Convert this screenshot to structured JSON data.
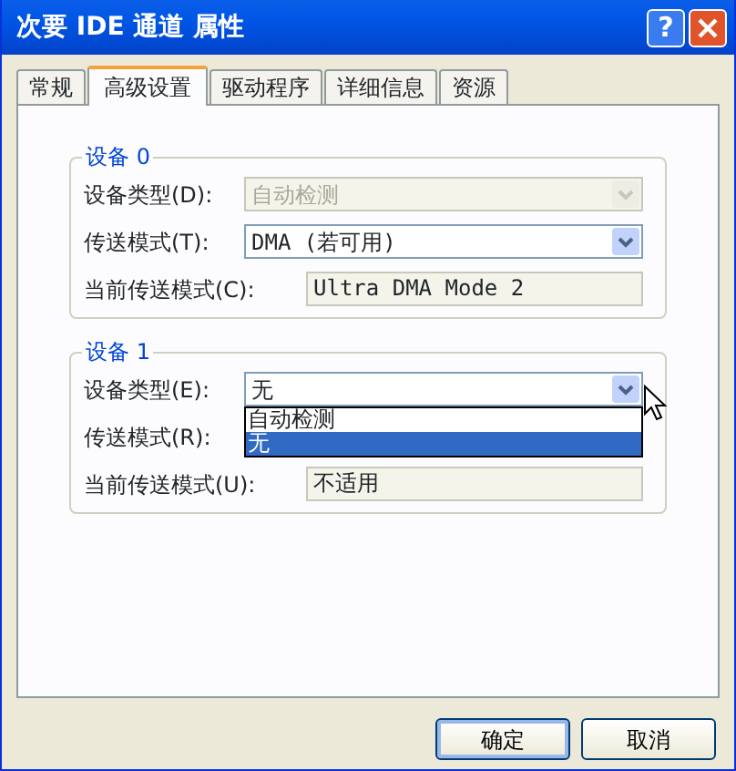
{
  "window": {
    "title": "次要 IDE 通道 属性",
    "help": "?"
  },
  "tabs": [
    {
      "label": "常规",
      "selected": false
    },
    {
      "label": "高级设置",
      "selected": true
    },
    {
      "label": "驱动程序",
      "selected": false
    },
    {
      "label": "详细信息",
      "selected": false
    },
    {
      "label": "资源",
      "selected": false
    }
  ],
  "groups": [
    {
      "title": "设备 0",
      "rows": [
        {
          "kind": "combo",
          "label": "设备类型(D):",
          "value": "自动检测",
          "disabled": true,
          "expanded": false
        },
        {
          "kind": "combo",
          "label": "传送模式(T):",
          "value": "DMA (若可用)",
          "disabled": false,
          "expanded": false
        },
        {
          "kind": "readonly",
          "label": "当前传送模式(C):",
          "value": "Ultra DMA Mode 2"
        }
      ]
    },
    {
      "title": "设备 1",
      "rows": [
        {
          "kind": "combo",
          "label": "设备类型(E):",
          "value": "无",
          "disabled": false,
          "expanded": true,
          "options": [
            {
              "label": "自动检测",
              "selected": false
            },
            {
              "label": "无",
              "selected": true
            }
          ]
        },
        {
          "kind": "label",
          "label": "传送模式(R):"
        },
        {
          "kind": "readonly",
          "label": "当前传送模式(U):",
          "value": "不适用"
        }
      ]
    }
  ],
  "buttons": [
    {
      "label": "确定",
      "default": true
    },
    {
      "label": "取消",
      "default": false
    }
  ]
}
